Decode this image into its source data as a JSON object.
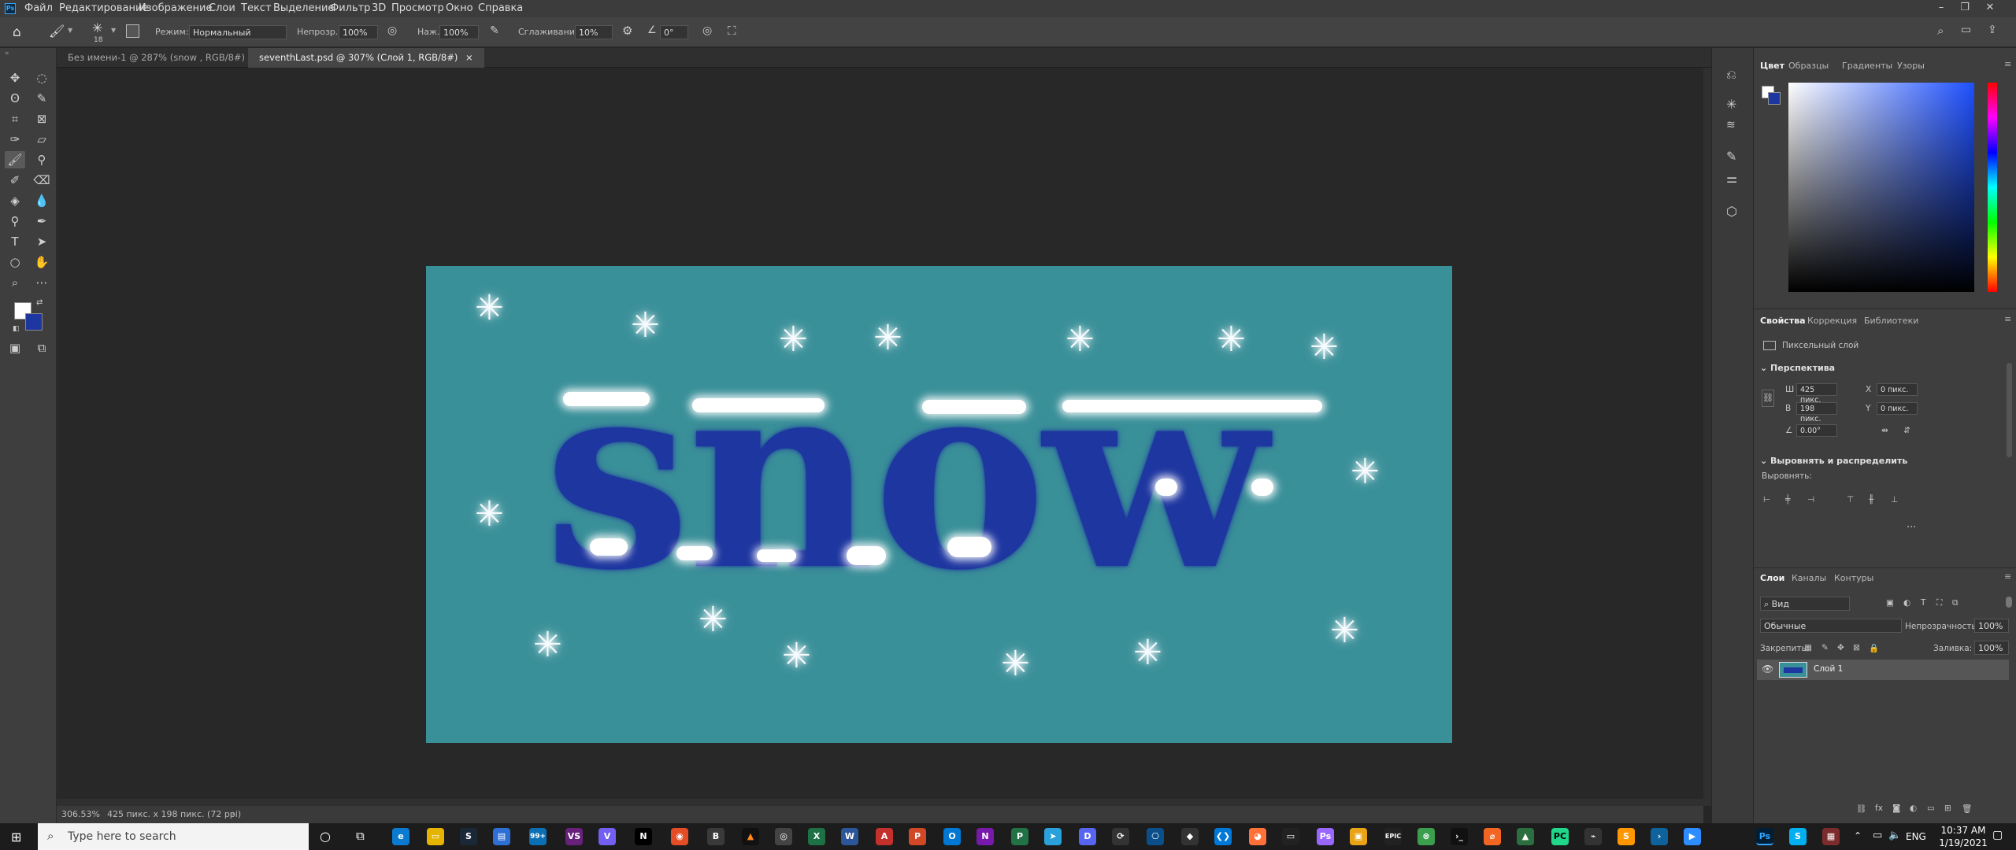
{
  "menu": {
    "logo": "Ps",
    "items": [
      "Файл",
      "Редактирование",
      "Изображение",
      "Слои",
      "Текст",
      "Выделение",
      "Фильтр",
      "3D",
      "Просмотр",
      "Окно",
      "Справка"
    ]
  },
  "window_controls": {
    "minimize": "–",
    "restore": "❐",
    "close": "✕"
  },
  "options": {
    "brush_size": "18",
    "mode_label": "Режим:",
    "mode_value": "Нормальный",
    "opacity_label": "Непрозр.:",
    "opacity_value": "100%",
    "pressure_label": "Наж.:",
    "pressure_value": "100%",
    "smoothing_label": "Сглаживание:",
    "smoothing_value": "10%",
    "angle_value": "0°"
  },
  "tabs": [
    {
      "label": "Без имени-1 @ 287% (snow , RGB/8#) *",
      "close": "×"
    },
    {
      "label": "seventhLast.psd @ 307% (Слой 1, RGB/8#)",
      "close": "×"
    }
  ],
  "canvas": {
    "text": "snow",
    "background_color": "#3a9099",
    "text_color": "#1e36a0"
  },
  "status": {
    "zoom": "306.53%",
    "doc_info": "425 пикс. x 198 пикс. (72 ppi)",
    "arrow": "›"
  },
  "color_panel": {
    "tabs": [
      "Цвет",
      "Образцы",
      "Градиенты",
      "Узоры"
    ],
    "foreground": "#ffffff",
    "background": "#1e36a0"
  },
  "properties_panel": {
    "tabs": [
      "Свойства",
      "Коррекция",
      "Библиотеки"
    ],
    "layer_type": "Пиксельный слой",
    "section_transform": "Перспектива",
    "w_label": "Ш",
    "w_value": "425 пикс.",
    "h_label": "В",
    "h_value": "198 пикс.",
    "x_label": "X",
    "x_value": "0 пикс.",
    "y_label": "Y",
    "y_value": "0 пикс.",
    "angle_value": "0.00°",
    "section_align": "Выровнять и распределить",
    "align_label": "Выровнять:",
    "more": "..."
  },
  "layers_panel": {
    "tabs": [
      "Слои",
      "Каналы",
      "Контуры"
    ],
    "filter_label": "Вид",
    "blend_mode": "Обычные",
    "opacity_label": "Непрозрачность:",
    "opacity_value": "100%",
    "lock_label": "Закрепить:",
    "fill_label": "Заливка:",
    "fill_value": "100%",
    "layer_name": "Слой 1"
  },
  "taskbar": {
    "search_placeholder": "Type here to search",
    "language": "ENG",
    "time": "10:37 AM",
    "date": "1/19/2021",
    "badge": "99+"
  }
}
